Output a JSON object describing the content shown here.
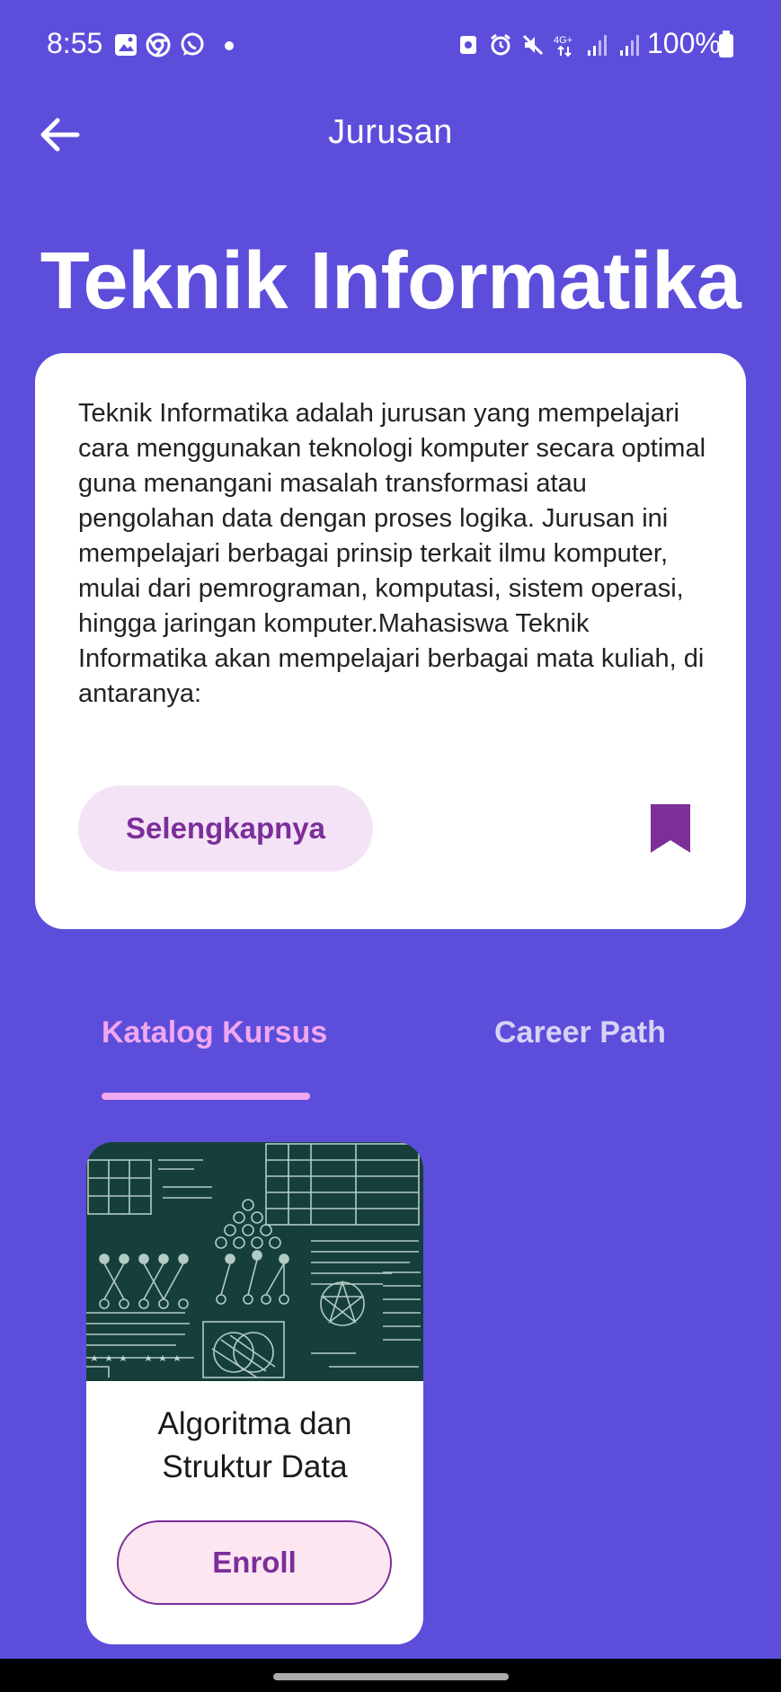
{
  "status_bar": {
    "time": "8:55",
    "battery": "100%",
    "left_icons": [
      "gallery-icon",
      "chrome-icon",
      "whatsapp-icon"
    ],
    "right_icons": [
      "screen-rotate-icon",
      "alarm-icon",
      "mute-icon",
      "network-4g-icon",
      "signal-icon",
      "signal-icon"
    ]
  },
  "app_bar": {
    "title": "Jurusan",
    "back_icon": "arrow-left-icon"
  },
  "major": {
    "title": "Teknik Informatika",
    "description": "Teknik Informatika adalah jurusan yang mempelajari cara menggunakan teknologi komputer secara optimal guna menangani masalah transformasi atau pengolahan data dengan proses logika. Jurusan ini mempelajari berbagai prinsip terkait ilmu komputer, mulai dari pemrograman, komputasi, sistem operasi, hingga jaringan komputer.Mahasiswa Teknik Informatika akan mempelajari berbagai mata kuliah, di antaranya:",
    "more_label": "Selengkapnya",
    "bookmark_icon": "bookmark-icon"
  },
  "tabs": [
    {
      "label": "Katalog Kursus",
      "active": true
    },
    {
      "label": "Career Path",
      "active": false
    }
  ],
  "courses": [
    {
      "title_line1": "Algoritma dan",
      "title_line2": "Struktur Data",
      "enroll_label": "Enroll",
      "image": "chalkboard-math-illustration"
    }
  ],
  "colors": {
    "background": "#5C4EDB",
    "accent": "#7C2E9A",
    "tab_active": "#F1A7F0",
    "tab_inactive": "#D8D2F5",
    "button_fill": "#F4E3F7"
  }
}
